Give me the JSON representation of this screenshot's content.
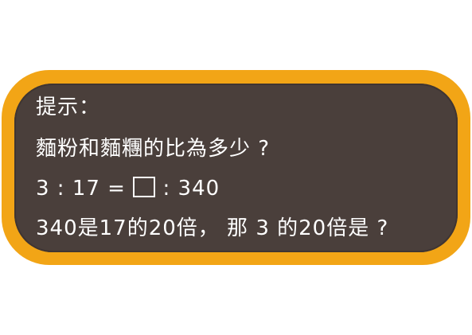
{
  "hint_card": {
    "title": "提示：",
    "question": "麵粉和麵糰的比為多少 ?",
    "equation": {
      "left": "3 : 17 = ",
      "right": " : 340"
    },
    "reasoning": "340是17的20倍， 那 3 的20倍是 ?"
  },
  "colors": {
    "frame": "#f2a516",
    "board": "#4a3f3b",
    "text": "#ffffff"
  }
}
